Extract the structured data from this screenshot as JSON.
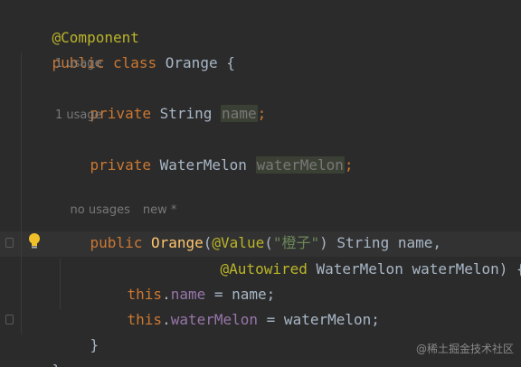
{
  "code": {
    "annotation_component": "@Component",
    "class_decl": {
      "kw_public": "public",
      "kw_class": "class",
      "name": "Orange",
      "brace": " {"
    },
    "hint1": "1 usage",
    "field1": {
      "kw": "private",
      "type": "String",
      "name": "name",
      "semi": ";"
    },
    "hint2": "1 usage",
    "field2": {
      "kw": "private",
      "type": "WaterMelon",
      "name": "waterMelon",
      "semi": ";"
    },
    "hint3": {
      "usages": "no usages",
      "status": "new *"
    },
    "ctor": {
      "kw": "public",
      "name": "Orange",
      "open_paren": "(",
      "value_anno": "@Value",
      "value_open": "(",
      "value_str": "\"橙子\"",
      "value_close": ")",
      "param1": " String name,",
      "autowired_anno": "@Autowired",
      "param2": " WaterMelon waterMelon) {"
    },
    "body1": {
      "this_kw": "this",
      "dot": ".",
      "field": "name",
      "rest": " = name;"
    },
    "body2": {
      "this_kw": "this",
      "dot": ".",
      "field": "waterMelon",
      "rest": " = waterMelon;"
    },
    "ctor_close": "}",
    "class_close": "}"
  },
  "watermark": "@稀土掘金技术社区",
  "icons": [
    "lightbulb-icon",
    "fold-marker-icon"
  ]
}
